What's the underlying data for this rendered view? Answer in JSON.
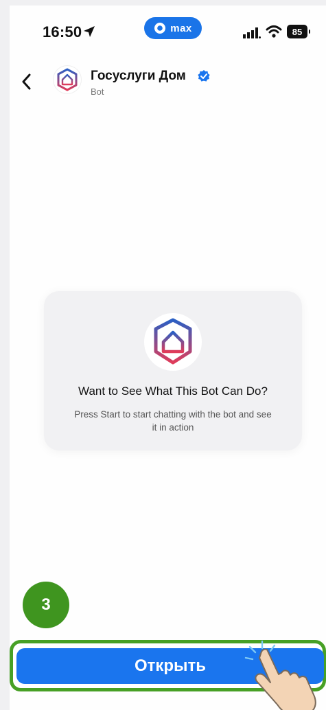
{
  "status_bar": {
    "time": "16:50",
    "pill_label": "max",
    "battery": "85",
    "icons": [
      "location-arrow-icon",
      "max-logo-icon",
      "signal-icon",
      "wifi-icon",
      "battery-icon"
    ]
  },
  "header": {
    "title": "Госуслуги Дом",
    "subtitle": "Bot",
    "icons": [
      "back-chevron-icon",
      "house-logo-icon",
      "verified-badge-icon"
    ]
  },
  "card": {
    "title": "Want to See What This Bot Can Do?",
    "description": "Press Start to start chatting with the bot and see it in action"
  },
  "annotation": {
    "step": "3"
  },
  "action": {
    "open_label": "Открыть"
  },
  "colors": {
    "accent": "#1a75ee",
    "highlight": "#47a025",
    "logo_blue": "#2a5fc4",
    "logo_red": "#e03c5a"
  }
}
